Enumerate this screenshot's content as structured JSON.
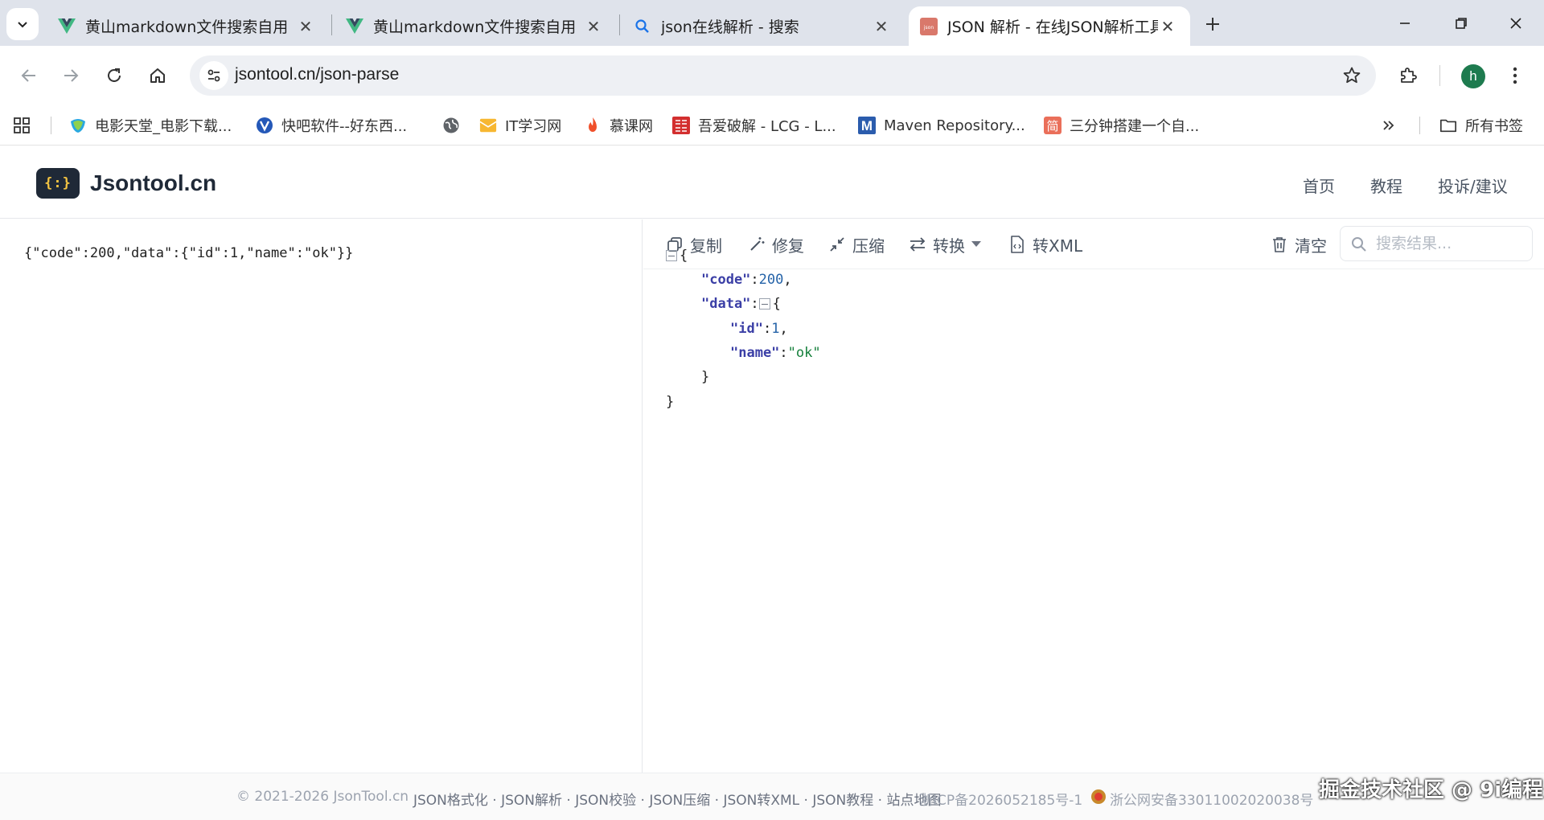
{
  "browser": {
    "tabs": [
      {
        "title": "黄山markdown文件搜索自用",
        "favicon": "vue-icon",
        "active": false
      },
      {
        "title": "黄山markdown文件搜索自用",
        "favicon": "vue-icon",
        "active": false
      },
      {
        "title": "json在线解析 - 搜索",
        "favicon": "search-icon",
        "active": false
      },
      {
        "title": "JSON 解析 - 在线JSON解析工具",
        "favicon": "json-site-icon",
        "active": true
      }
    ],
    "url": "jsontool.cn/json-parse",
    "avatar_letter": "h",
    "bookmarks": [
      {
        "label": "电影天堂_电影下载..."
      },
      {
        "label": "快吧软件--好东西..."
      },
      {
        "label": ""
      },
      {
        "label": "IT学习网"
      },
      {
        "label": "慕课网"
      },
      {
        "label": "吾爱破解 - LCG - L..."
      },
      {
        "label": "Maven Repository..."
      },
      {
        "label": "三分钟搭建一个自..."
      }
    ],
    "all_bookmarks": "所有书签",
    "maven_badge": "M",
    "jian_badge": "简",
    "avatar_color": "#1e7b4f"
  },
  "site": {
    "logo_mark": "{:}",
    "logo_text": "Jsontool.cn",
    "nav": [
      "首页",
      "教程",
      "投诉/建议"
    ]
  },
  "editor": {
    "input": "{\"code\":200,\"data\":{\"id\":1,\"name\":\"ok\"}}"
  },
  "result": {
    "toolbar": {
      "copy": "复制",
      "repair": "修复",
      "compress": "压缩",
      "convert": "转换",
      "to_xml": "转XML",
      "clear": "清空",
      "search_placeholder": "搜索结果..."
    },
    "tree": {
      "open_brace": "{",
      "close_brace": "}",
      "code_key": "\"code\"",
      "code_value": "200",
      "data_key": "\"data\"",
      "id_key": "\"id\"",
      "id_value": "1",
      "name_key": "\"name\"",
      "name_value": "\"ok\""
    }
  },
  "footer": {
    "copyright": "© 2021-2026 JsonTool.cn",
    "links": "JSON格式化 · JSON解析 · JSON校验 · JSON压缩 · JSON转XML · JSON教程 · 站点地图",
    "icp": "浙ICP备2026052185号-1",
    "police": "浙公网安备33011002020038号"
  },
  "watermark": "掘金技术社区 @ 9i编程"
}
